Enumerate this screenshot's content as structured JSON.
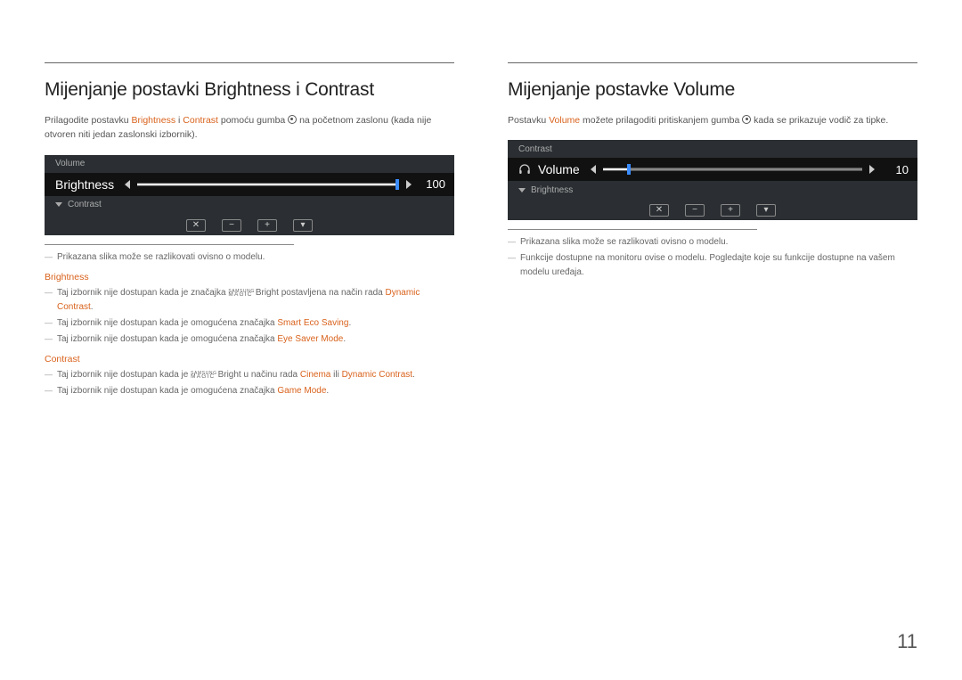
{
  "page_number": "11",
  "left": {
    "heading": "Mijenjanje postavki Brightness i Contrast",
    "intro_pre": "Prilagodite postavku ",
    "intro_b": "Brightness",
    "intro_and": " i ",
    "intro_c": "Contrast",
    "intro_post": " pomoću gumba ",
    "intro_tail": " na početnom zaslonu (kada nije otvoren niti jedan zaslonski izbornik).",
    "osd": {
      "top_label": "Volume",
      "main_label": "Brightness",
      "value": "100",
      "fill_pct": 100,
      "bottom_label": "Contrast"
    },
    "notes_general": [
      "Prikazana slika može se razlikovati ovisno o modelu."
    ],
    "section_brightness_title": "Brightness",
    "brightness_notes": {
      "n1_pre": "Taj izbornik nije dostupan kada je značajka ",
      "n1_mb": "Bright",
      "n1_mid": " postavljena na način rada ",
      "n1_dc": "Dynamic Contrast",
      "n2_pre": "Taj izbornik nije dostupan kada je omogućena značajka ",
      "n2_ses": "Smart Eco Saving",
      "n3_pre": "Taj izbornik nije dostupan kada je omogućena značajka ",
      "n3_esm": "Eye Saver Mode"
    },
    "section_contrast_title": "Contrast",
    "contrast_notes": {
      "n1_pre": "Taj izbornik nije dostupan kada je ",
      "n1_mb": "Bright",
      "n1_mid": " u načinu rada ",
      "n1_cin": "Cinema",
      "n1_or": " ili ",
      "n1_dc": "Dynamic Contrast",
      "n2_pre": "Taj izbornik nije dostupan kada je omogućena značajka ",
      "n2_gm": "Game Mode"
    }
  },
  "right": {
    "heading": "Mijenjanje postavke Volume",
    "intro_pre": "Postavku ",
    "intro_v": "Volume",
    "intro_mid": " možete prilagoditi pritiskanjem gumba ",
    "intro_tail": " kada se prikazuje vodič za tipke.",
    "osd": {
      "top_label": "Contrast",
      "main_label": "Volume",
      "value": "10",
      "fill_pct": 10,
      "bottom_label": "Brightness"
    },
    "notes": [
      "Prikazana slika može se razlikovati ovisno o modelu.",
      "Funkcije dostupne na monitoru ovise o modelu. Pogledajte koje su funkcije dostupne na vašem modelu uređaja."
    ]
  },
  "magic": {
    "top": "SAMSUNG",
    "bottom": "MAGIC"
  }
}
